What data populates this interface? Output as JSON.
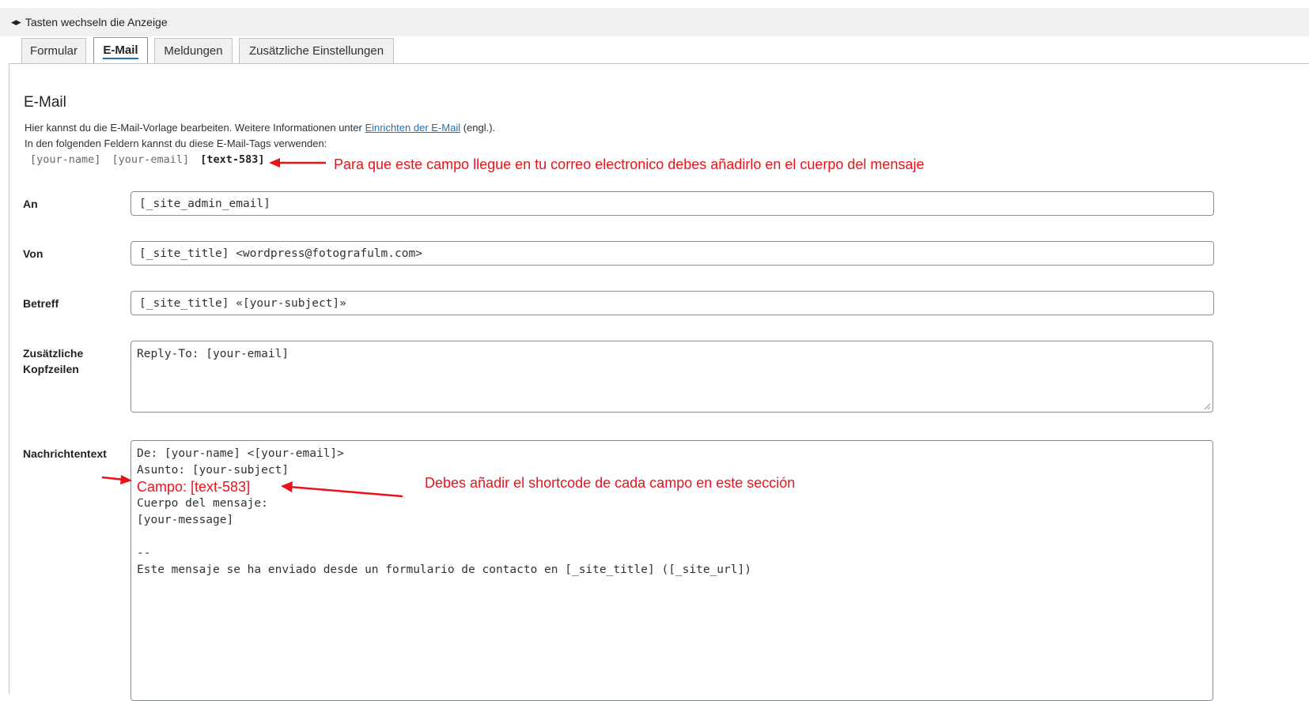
{
  "toggle": {
    "label": "Tasten wechseln die Anzeige"
  },
  "tabs": [
    {
      "label": "Formular"
    },
    {
      "label": "E-Mail",
      "active": true
    },
    {
      "label": "Meldungen"
    },
    {
      "label": "Zusätzliche Einstellungen"
    }
  ],
  "section": {
    "title": "E-Mail",
    "desc_prefix": "Hier kannst du die E-Mail-Vorlage bearbeiten. Weitere Informationen unter ",
    "desc_link": "Einrichten der E-Mail",
    "desc_suffix": " (engl.).",
    "desc_line2": "In den folgenden Feldern kannst du diese E-Mail-Tags verwenden:",
    "tags": [
      "[your-name]",
      "[your-email]",
      "[text-583]"
    ]
  },
  "annotations": {
    "top": "Para que este campo llegue en tu correo electronico debes añadirlo en el cuerpo del mensaje",
    "body": "Debes añadir el shortcode de cada campo en este sección"
  },
  "fields": {
    "an": {
      "label": "An",
      "value": "[_site_admin_email]"
    },
    "von": {
      "label": "Von",
      "value": "[_site_title] <wordpress@fotografulm.com>"
    },
    "betreff": {
      "label": "Betreff",
      "value": "[_site_title] «[your-subject]»"
    },
    "headers": {
      "label_line1": "Zusätzliche",
      "label_line2": "Kopfzeilen",
      "value": "Reply-To: [your-email]"
    },
    "body": {
      "label": "Nachrichtentext",
      "lines": [
        "De: [your-name] <[your-email]>",
        "Asunto: [your-subject]",
        "Campo: [text-583]",
        "Cuerpo del mensaje:",
        "[your-message]",
        "",
        "--",
        "Este mensaje se ha enviado desde un formulario de contacto en [_site_title] ([_site_url])"
      ]
    }
  },
  "colors": {
    "annotation": "#e8131a",
    "link": "#2271b1",
    "border": "#8c8f94"
  }
}
